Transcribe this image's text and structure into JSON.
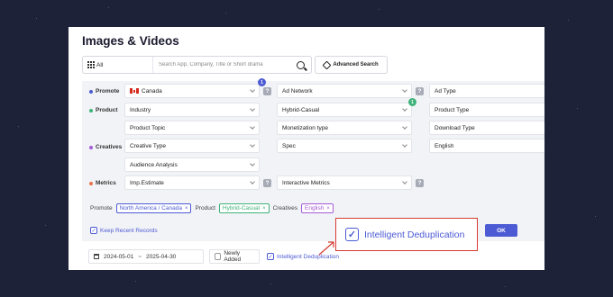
{
  "page": {
    "title": "Images & Videos"
  },
  "search": {
    "scope_label": "All",
    "placeholder": "Search App, Company, Title or Short drama",
    "advanced_label": "Advanced Search"
  },
  "filters": {
    "rows": {
      "promote": "Promote",
      "product": "Product",
      "creatives": "Creatives",
      "metrics": "Metrics"
    },
    "promote_country": "Canada",
    "promote_badge": "1",
    "ad_network": "Ad Network",
    "ad_type": "Ad Type",
    "industry": "Industry",
    "genre": "Hybrid-Casual",
    "genre_badge": "1",
    "product_type": "Product Type",
    "product_topic": "Product Topic",
    "monetization_type": "Monetization type",
    "download_type": "Download Type",
    "creative_type": "Creative Type",
    "spec": "Spec",
    "language": "English",
    "audience_analysis": "Audience Analysis",
    "imp_estimate": "Imp.Estimate",
    "interactive_metrics": "Interactive Metrics",
    "help_mark": "?"
  },
  "summary": {
    "promote_label": "Promote",
    "promote_chip": "North America / Canada",
    "product_label": "Product",
    "product_chip": "Hybrid-Casual",
    "creatives_label": "Creatives",
    "creatives_chip": "English",
    "chip_close": "×"
  },
  "keep_recent": "Keep Recent Records",
  "ok_label": "OK",
  "bottom": {
    "date_start": "2024-05-01",
    "date_sep": "~",
    "date_end": "2025-04-30",
    "newly_added": "Newly Added",
    "dedup_label": "Intelligent Deduplication"
  },
  "callout": {
    "label": "Intelligent Deduplication"
  },
  "colors": {
    "accent": "#4c5bd4",
    "promote_dot": "#4c5bd4",
    "product_dot": "#3fb37a",
    "creatives_dot": "#a45bd8",
    "metrics_dot": "#e8744a",
    "callout_border": "#d63a32"
  }
}
